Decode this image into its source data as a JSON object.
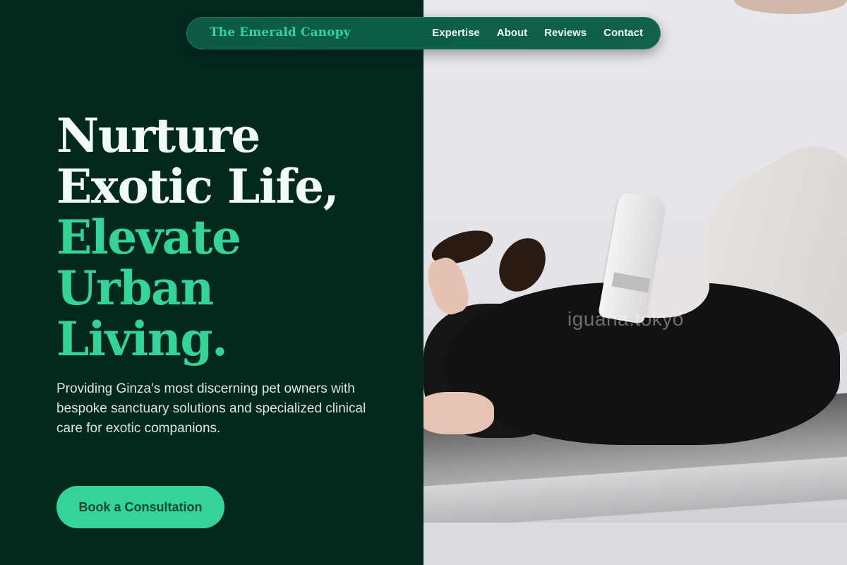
{
  "nav": {
    "brand": "The Emerald Canopy",
    "links": [
      "Expertise",
      "About",
      "Reviews",
      "Contact"
    ]
  },
  "hero": {
    "headline_light": [
      "Nurture",
      "Exotic Life,"
    ],
    "headline_accent": [
      "Elevate",
      "Urban",
      "Living."
    ],
    "lede": "Providing Ginza's most discerning pet owners with bespoke sanctuary solutions and specialized clinical care for exotic companions.",
    "cta": "Book a Consultation"
  },
  "photo": {
    "watermark": "iguana.tokyo"
  },
  "colors": {
    "background": "#03291f",
    "accent": "#36d398",
    "nav_bg": "#0b5e48",
    "text_light": "#f2fbf7"
  }
}
